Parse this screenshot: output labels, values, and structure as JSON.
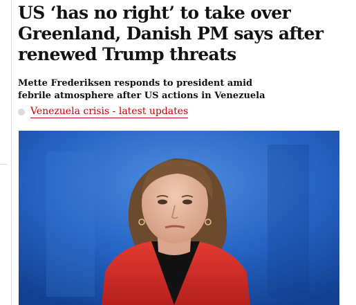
{
  "article": {
    "headline": "US ‘has no right’ to take over Greenland, Danish PM says after renewed Trump threats",
    "standfirst": "Mette Frederiksen responds to president amid febrile atmosphere after US actions in Venezuela",
    "related_link": "Venezuela crisis - latest updates"
  },
  "photo": {
    "subject": "woman-in-red-coat-portrait"
  },
  "colors": {
    "link": "#c70000",
    "text": "#121212",
    "background_blue": "#1d5fbf"
  }
}
